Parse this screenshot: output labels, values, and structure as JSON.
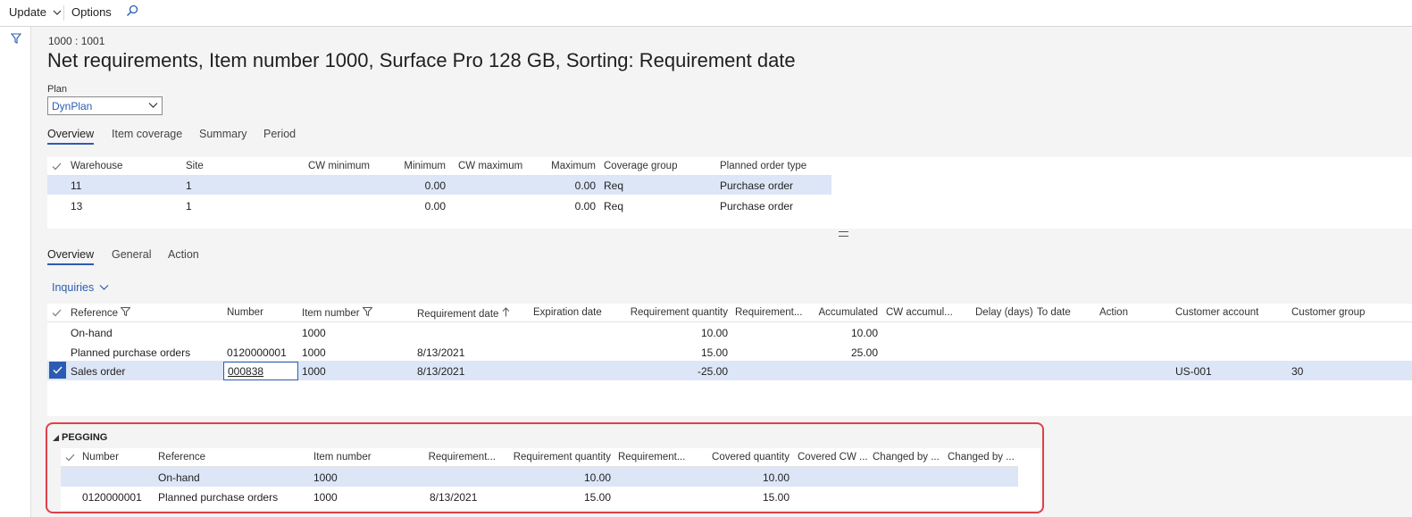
{
  "toolbar": {
    "update": "Update",
    "options": "Options"
  },
  "header": {
    "record_id": "1000 : 1001",
    "title": "Net requirements, Item number 1000, Surface Pro 128 GB, Sorting: Requirement date"
  },
  "plan": {
    "label": "Plan",
    "value": "DynPlan"
  },
  "top_tabs": [
    "Overview",
    "Item coverage",
    "Summary",
    "Period"
  ],
  "coverage_grid": {
    "columns": [
      "Warehouse",
      "Site",
      "CW minimum",
      "Minimum",
      "CW maximum",
      "Maximum",
      "Coverage group",
      "Planned order type"
    ],
    "rows": [
      [
        "11",
        "1",
        "",
        "0.00",
        "",
        "0.00",
        "Req",
        "Purchase order"
      ],
      [
        "13",
        "1",
        "",
        "0.00",
        "",
        "0.00",
        "Req",
        "Purchase order"
      ]
    ]
  },
  "lower_tabs": [
    "Overview",
    "General",
    "Action"
  ],
  "inquiries": "Inquiries",
  "req_grid": {
    "columns": [
      "Reference",
      "Number",
      "Item number",
      "Requirement date",
      "Expiration date",
      "Requirement quantity",
      "Requirement...",
      "Accumulated",
      "CW accumul...",
      "Delay (days)",
      "To date",
      "Action",
      "Customer account",
      "Customer group"
    ],
    "rows": [
      [
        "On-hand",
        "",
        "1000",
        "",
        "",
        "10.00",
        "",
        "10.00",
        "",
        "",
        "",
        "",
        "",
        ""
      ],
      [
        "Planned purchase orders",
        "0120000001",
        "1000",
        "8/13/2021",
        "",
        "15.00",
        "",
        "25.00",
        "",
        "",
        "",
        "",
        "",
        ""
      ],
      [
        "Sales order",
        "000838",
        "1000",
        "8/13/2021",
        "",
        "-25.00",
        "",
        "",
        "",
        "",
        "",
        "",
        "US-001",
        "30"
      ]
    ]
  },
  "pegging": {
    "title": "PEGGING",
    "columns": [
      "Number",
      "Reference",
      "Item number",
      "Requirement...",
      "Requirement quantity",
      "Requirement...",
      "Covered quantity",
      "Covered CW ...",
      "Changed by ...",
      "Changed by ..."
    ],
    "rows": [
      [
        "",
        "On-hand",
        "1000",
        "",
        "10.00",
        "",
        "10.00",
        "",
        "",
        ""
      ],
      [
        "0120000001",
        "Planned purchase orders",
        "1000",
        "8/13/2021",
        "15.00",
        "",
        "15.00",
        "",
        "",
        ""
      ]
    ]
  },
  "colors": {
    "accent": "#2b5cb3",
    "selected_row": "#dde6f7",
    "highlight_border": "#e0404a"
  }
}
